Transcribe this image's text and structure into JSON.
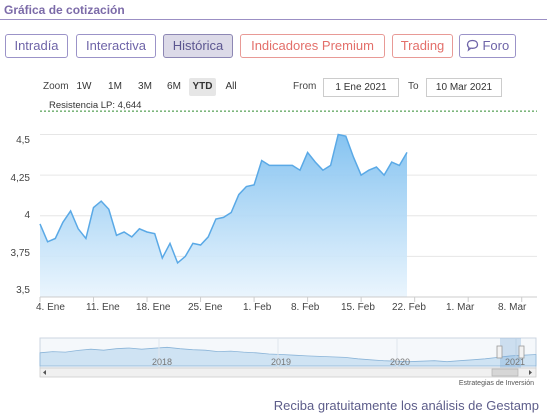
{
  "header": {
    "title": "Gráfica de cotización"
  },
  "tabs": [
    {
      "label": "Intradía",
      "active": false
    },
    {
      "label": "Interactiva",
      "active": false
    },
    {
      "label": "Histórica",
      "active": true
    },
    {
      "label": "Indicadores Premium",
      "active": false
    },
    {
      "label": "Trading",
      "active": false
    },
    {
      "label": "Foro",
      "active": false
    }
  ],
  "range_selector": {
    "zoom_label": "Zoom",
    "buttons": [
      "1W",
      "1M",
      "3M",
      "6M",
      "YTD",
      "All"
    ],
    "active": "YTD",
    "from_label": "From",
    "from_value": "1 Ene 2021",
    "to_label": "To",
    "to_value": "10 Mar 2021"
  },
  "colors": {
    "accent": "#7b6aa8",
    "line": "#5aa9e6",
    "area_top": "#7fc0f0",
    "area_bottom": "#e8f4fd",
    "resistance": "#2e8b2e",
    "premium": "#e36f6a"
  },
  "chart_data": {
    "type": "area",
    "annotation": "Resistencia LP: 4,644",
    "resistance_value": 4.644,
    "y_ticks": [
      "4,5",
      "4,25",
      "4",
      "3,75",
      "3,5"
    ],
    "y_tick_values": [
      4.5,
      4.25,
      4.0,
      3.75,
      3.5
    ],
    "ylim": [
      3.5,
      4.62
    ],
    "x_ticks": [
      "4. Ene",
      "11. Ene",
      "18. Ene",
      "25. Ene",
      "1. Feb",
      "8. Feb",
      "15. Feb",
      "22. Feb",
      "1. Mar",
      "8. Mar"
    ],
    "x_tick_days": [
      4,
      11,
      18,
      25,
      32,
      39,
      46,
      53,
      60,
      67
    ],
    "xlim": [
      4,
      69
    ],
    "x_unit": "day of 2021",
    "values": [
      [
        4,
        3.95
      ],
      [
        5,
        3.84
      ],
      [
        6,
        3.86
      ],
      [
        7,
        3.96
      ],
      [
        8,
        4.03
      ],
      [
        9,
        3.92
      ],
      [
        10,
        3.86
      ],
      [
        11,
        4.05
      ],
      [
        12,
        4.09
      ],
      [
        13,
        4.04
      ],
      [
        14,
        3.88
      ],
      [
        15,
        3.9
      ],
      [
        16,
        3.87
      ],
      [
        17,
        3.92
      ],
      [
        18,
        3.9
      ],
      [
        19,
        3.89
      ],
      [
        20,
        3.74
      ],
      [
        21,
        3.83
      ],
      [
        22,
        3.71
      ],
      [
        23,
        3.75
      ],
      [
        24,
        3.83
      ],
      [
        25,
        3.82
      ],
      [
        26,
        3.87
      ],
      [
        27,
        3.98
      ],
      [
        28,
        3.99
      ],
      [
        29,
        4.02
      ],
      [
        30,
        4.13
      ],
      [
        31,
        4.18
      ],
      [
        32,
        4.19
      ],
      [
        33,
        4.34
      ],
      [
        34,
        4.31
      ],
      [
        35,
        4.31
      ],
      [
        36,
        4.31
      ],
      [
        37,
        4.31
      ],
      [
        38,
        4.28
      ],
      [
        39,
        4.39
      ],
      [
        40,
        4.33
      ],
      [
        41,
        4.28
      ],
      [
        42,
        4.31
      ],
      [
        43,
        4.5
      ],
      [
        44,
        4.49
      ],
      [
        45,
        4.36
      ],
      [
        46,
        4.25
      ],
      [
        47,
        4.28
      ],
      [
        48,
        4.3
      ],
      [
        49,
        4.25
      ],
      [
        50,
        4.33
      ],
      [
        51,
        4.31
      ],
      [
        52,
        4.39
      ]
    ]
  },
  "navigator": {
    "years": [
      "2018",
      "2019",
      "2020",
      "2021"
    ],
    "series": [
      0.55,
      0.6,
      0.58,
      0.65,
      0.7,
      0.66,
      0.72,
      0.75,
      0.7,
      0.74,
      0.78,
      0.72,
      0.68,
      0.66,
      0.6,
      0.62,
      0.58,
      0.55,
      0.5,
      0.48,
      0.45,
      0.42,
      0.4,
      0.38,
      0.36,
      0.3,
      0.26,
      0.22,
      0.2,
      0.18,
      0.2,
      0.22,
      0.18,
      0.22,
      0.26,
      0.3,
      0.36,
      0.42,
      0.45,
      0.48
    ]
  },
  "credit": "Estrategias de Inversión",
  "footer": {
    "text": "Reciba gratuitamente los análisis de Gestamp"
  }
}
